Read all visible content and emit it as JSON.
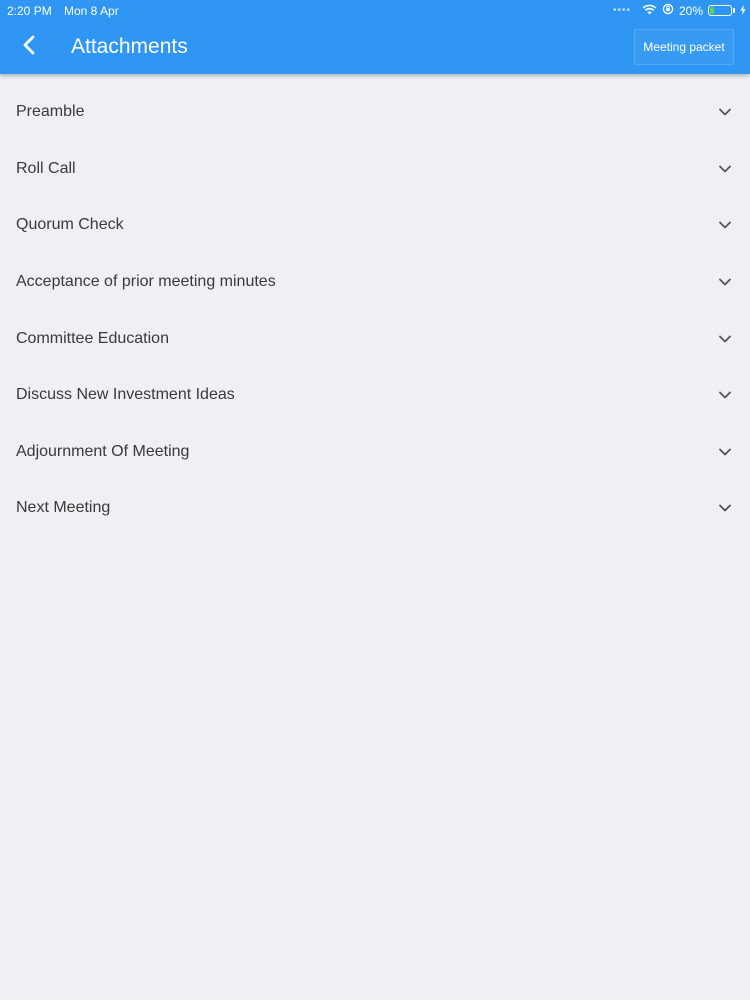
{
  "status_bar": {
    "time": "2:20 PM",
    "date": "Mon 8 Apr",
    "battery_percent": "20%",
    "battery_level": 0.2
  },
  "header": {
    "title": "Attachments",
    "meeting_packet_label": "Meeting packet",
    "back_icon": "chevron-left-icon"
  },
  "agenda": {
    "items": [
      {
        "label": "Preamble"
      },
      {
        "label": "Roll Call"
      },
      {
        "label": "Quorum Check"
      },
      {
        "label": "Acceptance of prior meeting minutes"
      },
      {
        "label": "Committee Education"
      },
      {
        "label": "Discuss New Investment Ideas"
      },
      {
        "label": "Adjournment Of Meeting"
      },
      {
        "label": "Next Meeting"
      }
    ],
    "expand_icon": "chevron-down-icon"
  },
  "colors": {
    "header_bg": "#2f96f3",
    "page_bg": "#efeff4",
    "battery_fill": "#4cd964"
  }
}
